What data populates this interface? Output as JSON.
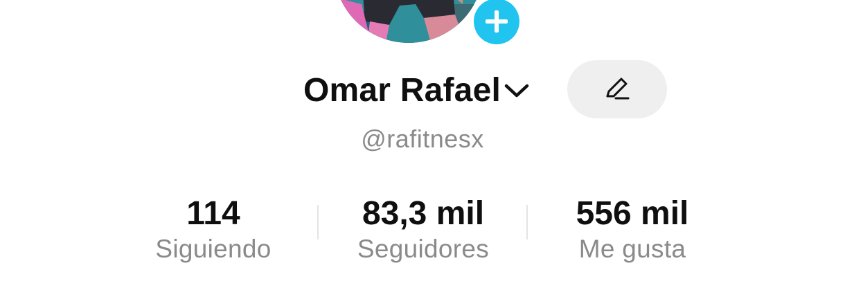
{
  "profile": {
    "display_name": "Omar Rafael",
    "username": "@rafitnesx"
  },
  "stats": [
    {
      "value": "114",
      "label": "Siguiendo"
    },
    {
      "value": "83,3 mil",
      "label": "Seguidores"
    },
    {
      "value": "556 mil",
      "label": "Me gusta"
    }
  ],
  "icons": {
    "add": "plus-icon",
    "dropdown": "chevron-down-icon",
    "edit": "pencil-icon"
  },
  "colors": {
    "accent": "#20c4ef",
    "text_primary": "#0f0f0f",
    "text_secondary": "#8a8a8a",
    "button_bg": "#efefef"
  }
}
